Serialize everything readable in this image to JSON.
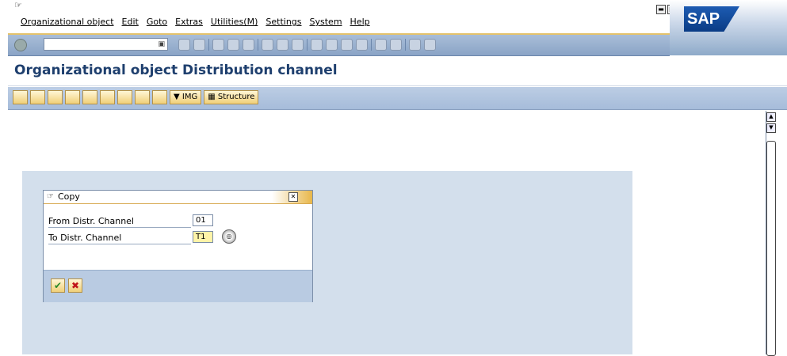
{
  "menu": {
    "items": [
      "Organizational object",
      "Edit",
      "Goto",
      "Extras",
      "Utilities(M)",
      "Settings",
      "System",
      "Help"
    ]
  },
  "brand": {
    "logo_text": "SAP"
  },
  "toolbar": {
    "command_value": "",
    "icons": [
      "enter-icon",
      "back-icon",
      "save-icon",
      "back-nav-icon",
      "exit-icon",
      "cancel-icon",
      "print-icon",
      "find-icon",
      "find-next-icon",
      "first-page-icon",
      "prev-page-icon",
      "next-page-icon",
      "last-page-icon",
      "new-session-icon",
      "shortcut-icon",
      "help-icon",
      "layout-icon"
    ]
  },
  "title": {
    "text": "Organizational object Distribution channel"
  },
  "app_toolbar": {
    "icons": [
      "change-icon",
      "copy-icon",
      "copy-with-reference-icon",
      "delete-icon",
      "transport-icon",
      "truck-icon",
      "check-icon",
      "assign-icon",
      "info-icon"
    ],
    "img_label": "IMG",
    "structure_label": "Structure"
  },
  "dialog": {
    "title": "Copy",
    "from_label": "From Distr. Channel",
    "from_value": "01",
    "to_label": "To Distr. Channel",
    "to_value": "T1"
  },
  "colors": {
    "accent": "#1e3f6e",
    "toolbar": "#a6bcda",
    "active_field": "#fff4a8"
  }
}
